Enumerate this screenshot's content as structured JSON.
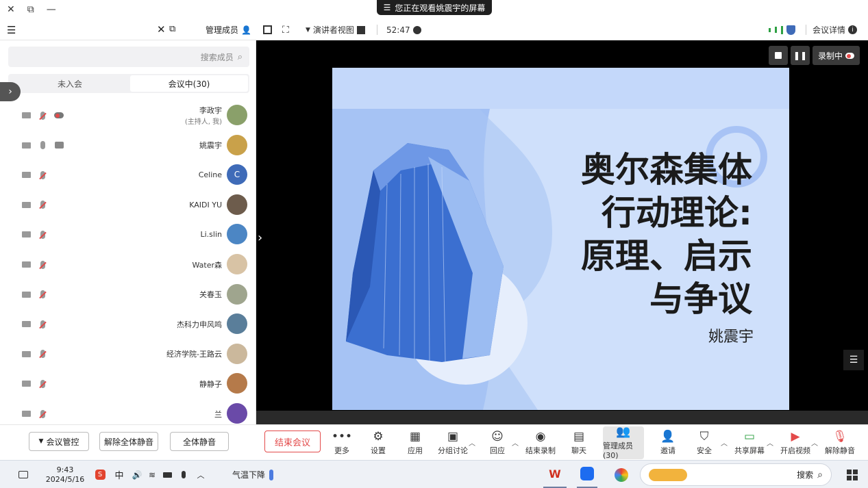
{
  "share_banner": {
    "text": "您正在观看姚震宇的屏幕"
  },
  "window_controls": {
    "close": "✕",
    "restore": "⧉",
    "minimize": "—"
  },
  "meeting_toolbar": {
    "meeting_info": "会议详情",
    "timer": "52:47",
    "view_label": "演讲者视图"
  },
  "panel": {
    "title": "管理成员",
    "search_placeholder": "搜索成员",
    "tab_in_meeting": "会议中(30)",
    "tab_not_joined": "未入会",
    "collapse_glyph": "›",
    "participants": [
      {
        "name": "李政宇",
        "sub": "(主持人, 我)",
        "avatar_text": "",
        "avatar_color": "#8aa06a"
      },
      {
        "name": "姚震宇",
        "sub": "",
        "avatar_text": "",
        "avatar_color": "#c9a14a"
      },
      {
        "name": "Celine",
        "sub": "",
        "avatar_text": "C",
        "avatar_color": "#3f6bb8"
      },
      {
        "name": "KAIDI YU",
        "sub": "",
        "avatar_text": "",
        "avatar_color": "#6d5c4c"
      },
      {
        "name": "Li.slin",
        "sub": "",
        "avatar_text": "",
        "avatar_color": "#4c86c4"
      },
      {
        "name": "Water森",
        "sub": "",
        "avatar_text": "",
        "avatar_color": "#d8c3a5"
      },
      {
        "name": "关春玉",
        "sub": "",
        "avatar_text": "",
        "avatar_color": "#9fa58e"
      },
      {
        "name": "杰科力申风鸣",
        "sub": "",
        "avatar_text": "",
        "avatar_color": "#5a7e9a"
      },
      {
        "name": "经济学院-王路云",
        "sub": "",
        "avatar_text": "",
        "avatar_color": "#cbb89c"
      },
      {
        "name": "静静子",
        "sub": "",
        "avatar_text": "",
        "avatar_color": "#b57a4a"
      },
      {
        "name": "兰",
        "sub": "",
        "avatar_text": "",
        "avatar_color": "#6a4aa8"
      }
    ],
    "bottom": {
      "mute_all": "全体静音",
      "unmute_all": "解除全体静音",
      "meeting_control": "会议管控"
    }
  },
  "slide": {
    "title_lines": [
      "奥尔森集体",
      "行动理论:",
      "原理、启示",
      "与争议"
    ],
    "author": "姚震宇"
  },
  "recording": {
    "label": "录制中"
  },
  "controls": {
    "end_meeting": "结束会议",
    "items": [
      {
        "label": "更多",
        "icon": "more-icon",
        "glyph": "•••"
      },
      {
        "label": "设置",
        "icon": "gear-icon",
        "glyph": "⚙"
      },
      {
        "label": "应用",
        "icon": "apps-icon",
        "glyph": "▦"
      },
      {
        "label": "分组讨论",
        "icon": "breakout-icon",
        "glyph": "▣"
      },
      {
        "label": "回应",
        "icon": "reaction-icon",
        "glyph": "☺"
      },
      {
        "label": "结束录制",
        "icon": "stop-record-icon",
        "glyph": "◉"
      },
      {
        "label": "聊天",
        "icon": "chat-icon",
        "glyph": "▤"
      },
      {
        "label": "管理成员(30)",
        "icon": "members-icon",
        "glyph": "👥"
      },
      {
        "label": "邀请",
        "icon": "invite-icon",
        "glyph": "👤"
      },
      {
        "label": "安全",
        "icon": "shield-icon",
        "glyph": "⛉"
      },
      {
        "label": "共享屏幕",
        "icon": "share-screen-icon",
        "glyph": "▭"
      },
      {
        "label": "开启视频",
        "icon": "video-off-icon",
        "glyph": "▶"
      },
      {
        "label": "解除静音",
        "icon": "mic-off-icon",
        "glyph": "🎙"
      }
    ]
  },
  "taskbar": {
    "search": "搜索",
    "weather": "气温下降",
    "ime": "中",
    "time": "9:43",
    "date": "2024/5/16"
  },
  "colors": {
    "end_red": "#e34a4a",
    "slide_bg": "#cfe0fb",
    "accent_blue": "#3f6bb8",
    "signal_green": "#2ea043"
  }
}
